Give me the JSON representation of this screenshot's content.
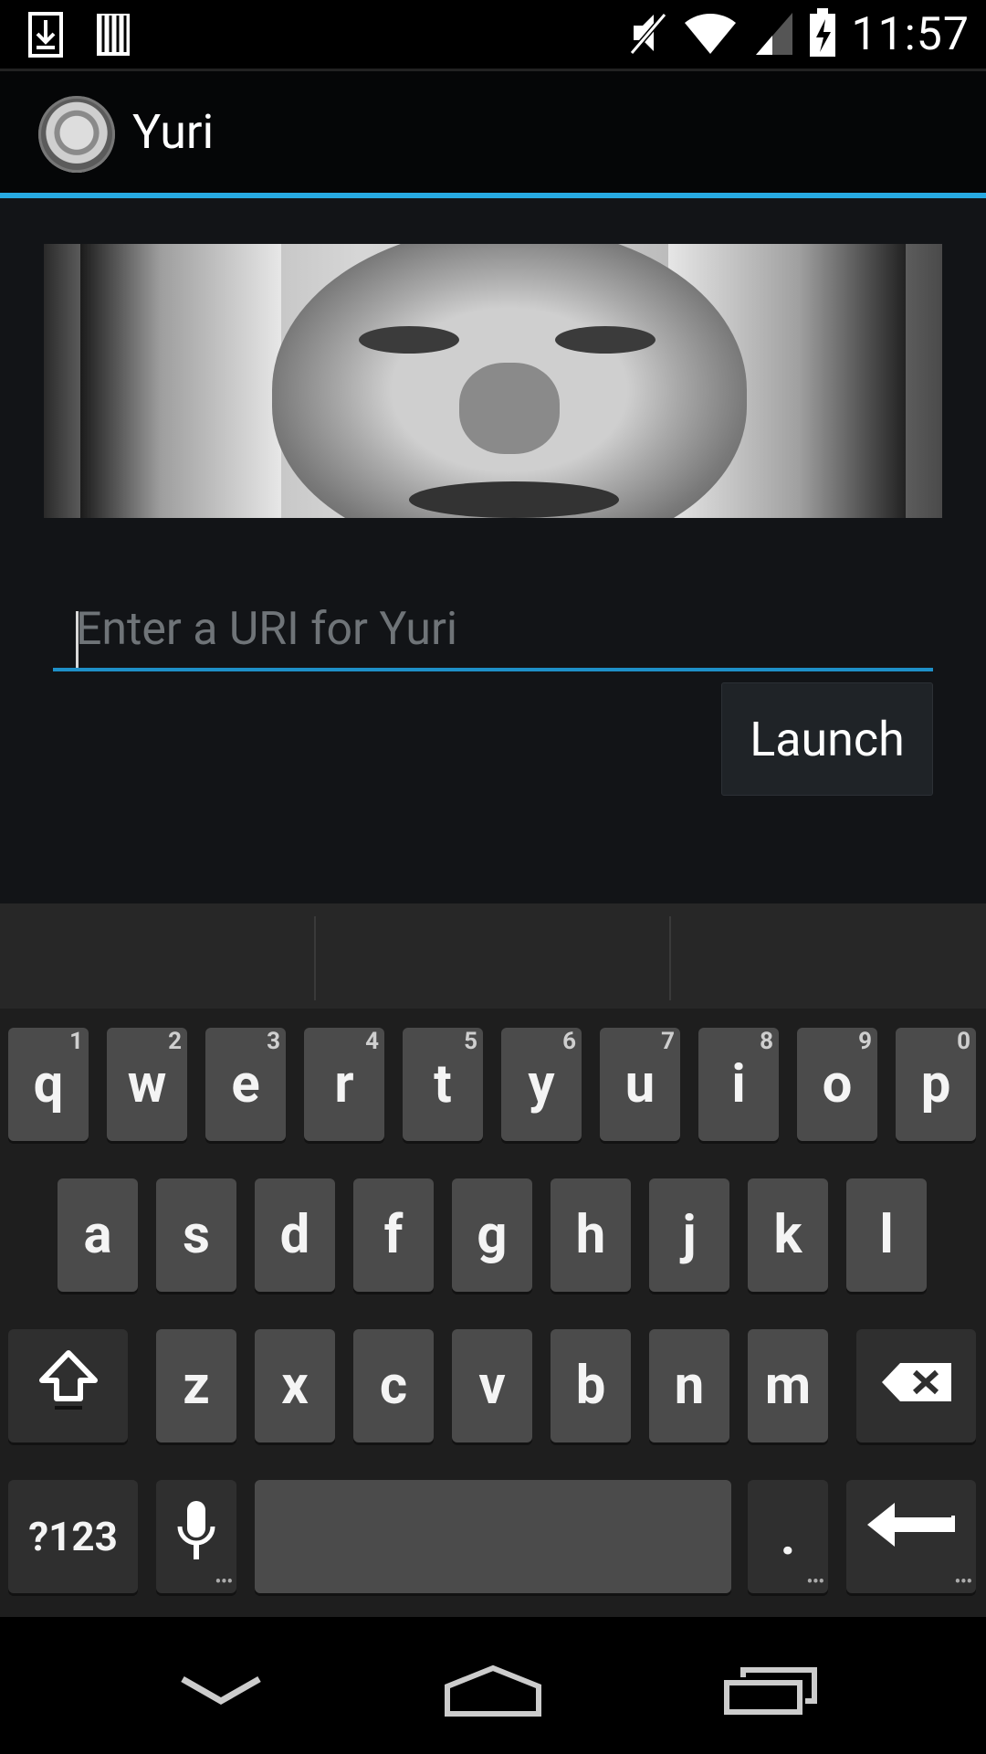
{
  "status_bar": {
    "time": "11:57"
  },
  "action_bar": {
    "title": "Yuri"
  },
  "main": {
    "uri_placeholder": "Enter a URI for Yuri",
    "launch_label": "Launch"
  },
  "keyboard": {
    "row1": [
      {
        "key": "q",
        "hint": "1"
      },
      {
        "key": "w",
        "hint": "2"
      },
      {
        "key": "e",
        "hint": "3"
      },
      {
        "key": "r",
        "hint": "4"
      },
      {
        "key": "t",
        "hint": "5"
      },
      {
        "key": "y",
        "hint": "6"
      },
      {
        "key": "u",
        "hint": "7"
      },
      {
        "key": "i",
        "hint": "8"
      },
      {
        "key": "o",
        "hint": "9"
      },
      {
        "key": "p",
        "hint": "0"
      }
    ],
    "row2": [
      "a",
      "s",
      "d",
      "f",
      "g",
      "h",
      "j",
      "k",
      "l"
    ],
    "row3": [
      "z",
      "x",
      "c",
      "v",
      "b",
      "n",
      "m"
    ],
    "symbols_label": "?123",
    "period_label": "."
  },
  "icons": {
    "status_left": [
      "download-icon",
      "sd-card-icon"
    ],
    "status_right": [
      "muted-speaker-icon",
      "wifi-icon",
      "signal-icon",
      "battery-charging-icon"
    ],
    "nav": [
      "back-icon",
      "home-icon",
      "recents-icon"
    ]
  },
  "colors": {
    "accent": "#27a9e1"
  }
}
